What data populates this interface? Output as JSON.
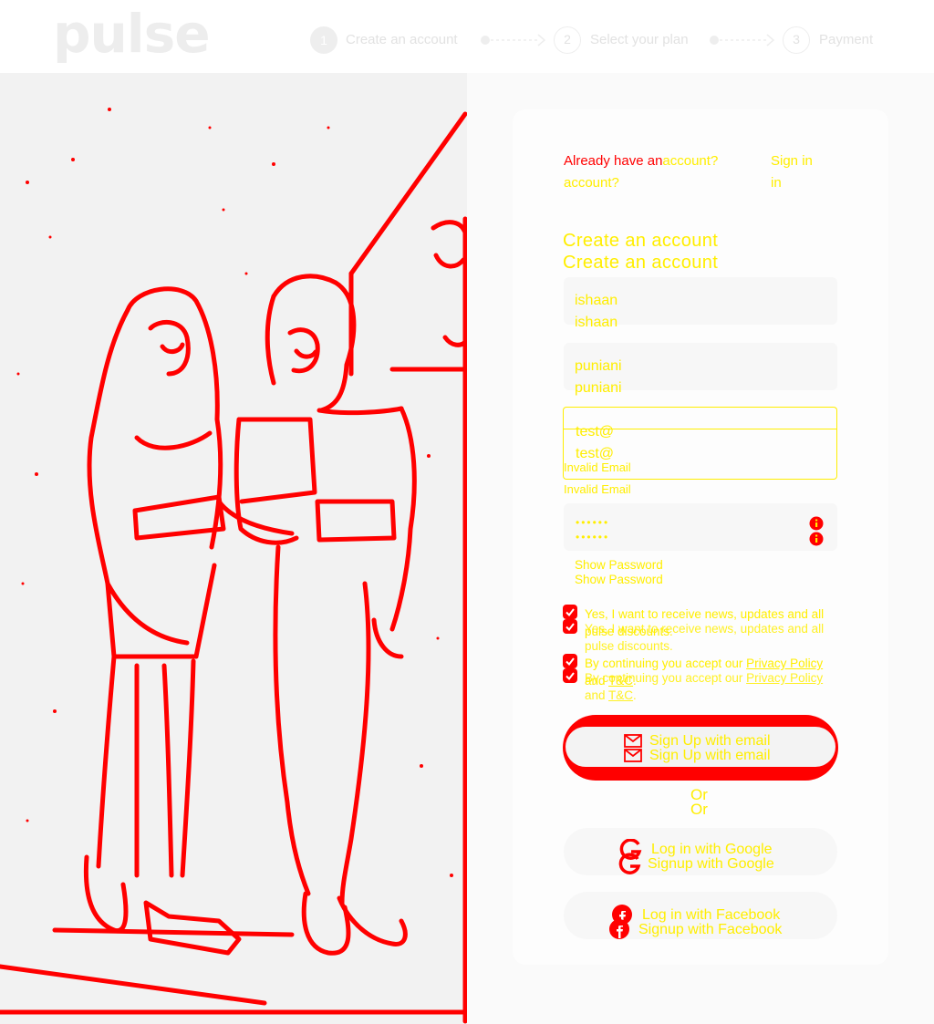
{
  "app": {
    "logo_text": "pulse"
  },
  "steps": [
    {
      "number": "1",
      "label": "Create an account",
      "state": "active"
    },
    {
      "number": "2",
      "label": "Select your plan",
      "state": "idle"
    },
    {
      "number": "3",
      "label": "Payment",
      "state": "idle"
    }
  ],
  "signin_prompt": {
    "text_red": "Already have an",
    "text_yellow_tail": "account?",
    "wrap_line": "account?",
    "link_label": "Sign in",
    "link_wrap": "in"
  },
  "form": {
    "title": "Create an account",
    "first_name_value": "ishaan",
    "last_name_value": "puniani",
    "email_value": "test@",
    "email_error": "Invalid Email",
    "password_mask": "••••••",
    "show_password_label": "Show Password",
    "marketing_consent": "Yes, I want to receive news, updates and all pulse discounts.",
    "terms_prefix": "By continuing you accept our",
    "privacy_label": "Privacy Policy",
    "terms_and": "and",
    "tc_label": "T&C",
    "terms_suffix": ".",
    "signup_email_label": "Sign Up with email",
    "or_label": "Or",
    "google_login_label": "Log in with Google",
    "google_signup_label": "Signup with Google",
    "facebook_login_label": "Log in with Facebook",
    "facebook_signup_label": "Signup with Facebook"
  },
  "icons": {
    "info": "info-icon",
    "mail": "envelope-icon",
    "google": "google-icon",
    "facebook": "facebook-icon",
    "check": "check-icon"
  },
  "colors": {
    "accent_red": "#ff0000",
    "accent_yellow": "#ffee00"
  }
}
